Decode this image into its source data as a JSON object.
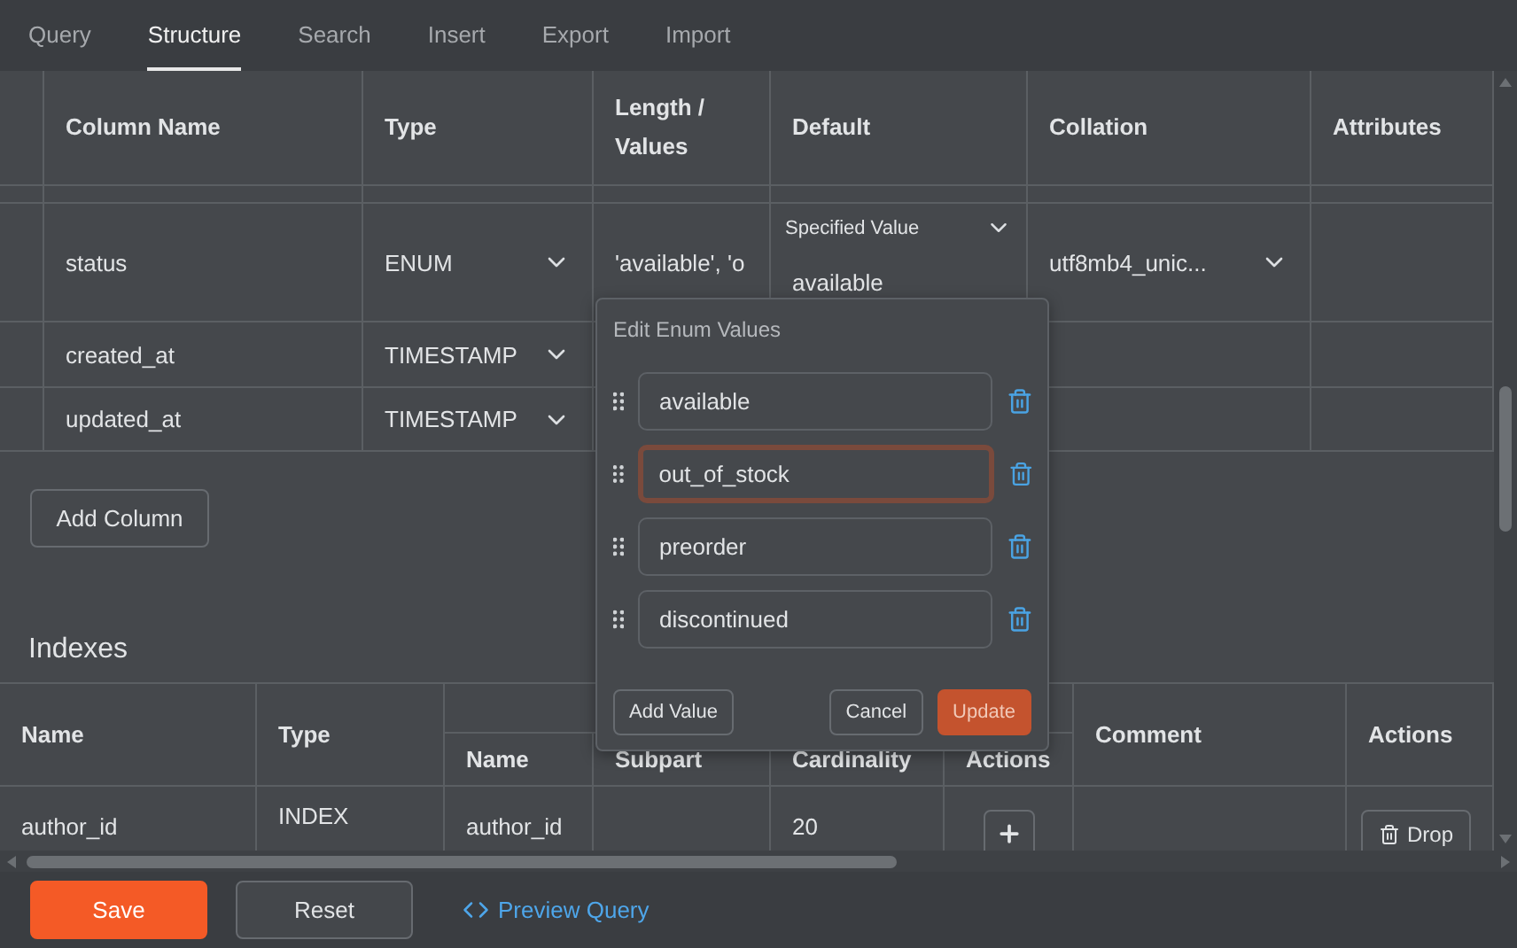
{
  "tabs": [
    {
      "label": "Query",
      "selected": false
    },
    {
      "label": "Structure",
      "selected": true
    },
    {
      "label": "Search",
      "selected": false
    },
    {
      "label": "Insert",
      "selected": false
    },
    {
      "label": "Export",
      "selected": false
    },
    {
      "label": "Import",
      "selected": false
    }
  ],
  "columns_table": {
    "headers": [
      "Column Name",
      "Type",
      "Length / Values",
      "Default",
      "Collation",
      "Attributes"
    ],
    "rows": [
      {
        "name": "status",
        "type": "ENUM",
        "length": "'available', 'o",
        "default_mode": "Specified Value",
        "default_value": "available",
        "collation": "utf8mb4_unic..."
      },
      {
        "name": "created_at",
        "type": "TIMESTAMP"
      },
      {
        "name": "updated_at",
        "type": "TIMESTAMP"
      }
    ]
  },
  "add_column_button": "Add Column",
  "enum_editor": {
    "title": "Edit Enum Values",
    "values": [
      {
        "value": "available",
        "focused": false
      },
      {
        "value": "out_of_stock",
        "focused": true
      },
      {
        "value": "preorder",
        "focused": false
      },
      {
        "value": "discontinued",
        "focused": false
      }
    ],
    "add_button": "Add Value",
    "cancel_button": "Cancel",
    "update_button": "Update"
  },
  "indexes": {
    "title": "Indexes",
    "headers": [
      "Name",
      "Type",
      "Comment",
      "Actions"
    ],
    "subheaders": [
      "Name",
      "Subpart",
      "Cardinality",
      "Actions"
    ],
    "rows": [
      {
        "name": "author_id",
        "type": "INDEX",
        "column": "author_id",
        "cardinality": "20",
        "drop_button": "Drop"
      }
    ]
  },
  "footer": {
    "save_button": "Save",
    "reset_button": "Reset",
    "preview_link": "Preview Query"
  }
}
